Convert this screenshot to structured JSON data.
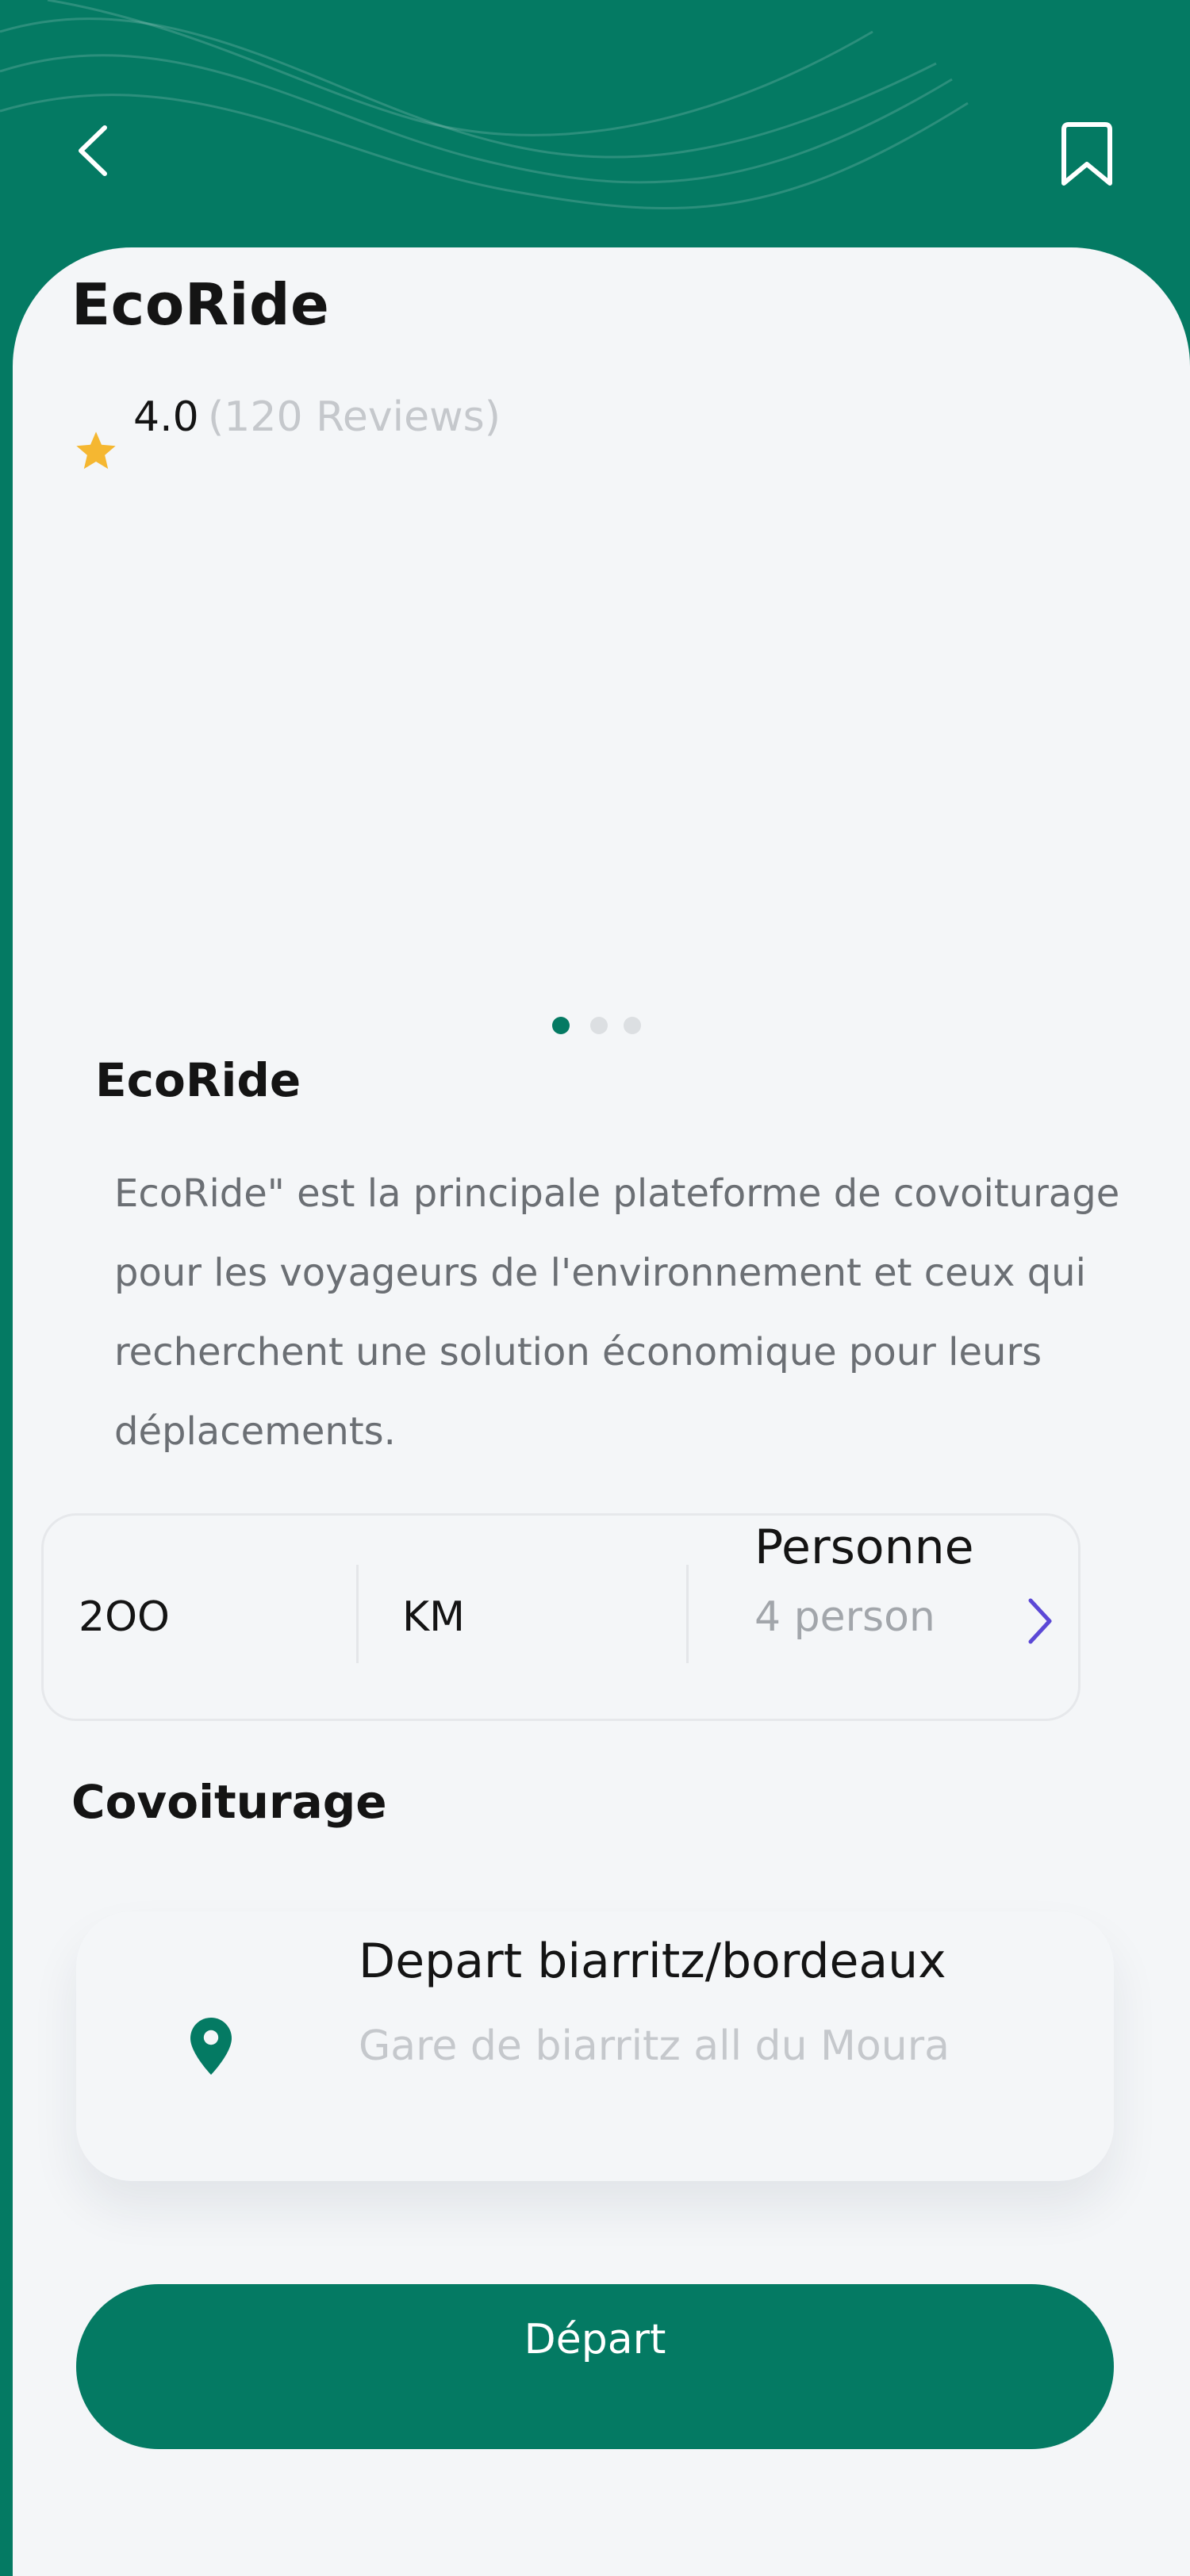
{
  "app": {
    "title": "EcoRide"
  },
  "rating": {
    "value": "4.0",
    "reviews": "(120 Reviews)",
    "stars": 4.0
  },
  "carousel": {
    "active_index": 0,
    "count": 3
  },
  "about": {
    "title": "EcoRide",
    "description": "EcoRide\" est  la principale plateforme de covoiturage pour les voyageurs de l'environnement et ceux qui recherchent une solution économique pour leurs déplacements."
  },
  "stats": {
    "distance": "2OO",
    "unit": "KM",
    "person_label": "Personne",
    "person_value": "4 person"
  },
  "covoiturage": {
    "title": "Covoiturage",
    "route_title": "Depart biarritz/bordeaux",
    "route_subtitle": "Gare de biarritz all du Moura"
  },
  "actions": {
    "depart_label": "Départ"
  },
  "colors": {
    "primary": "#047a63",
    "background": "#f4f6f8",
    "star": "#f5b731",
    "chevron": "#5b48d6",
    "muted_text": "#c5c8cc"
  },
  "icons": {
    "back": "chevron-left-icon",
    "bookmark": "bookmark-icon",
    "star": "star-icon",
    "next": "chevron-right-icon",
    "location": "map-pin-icon"
  }
}
